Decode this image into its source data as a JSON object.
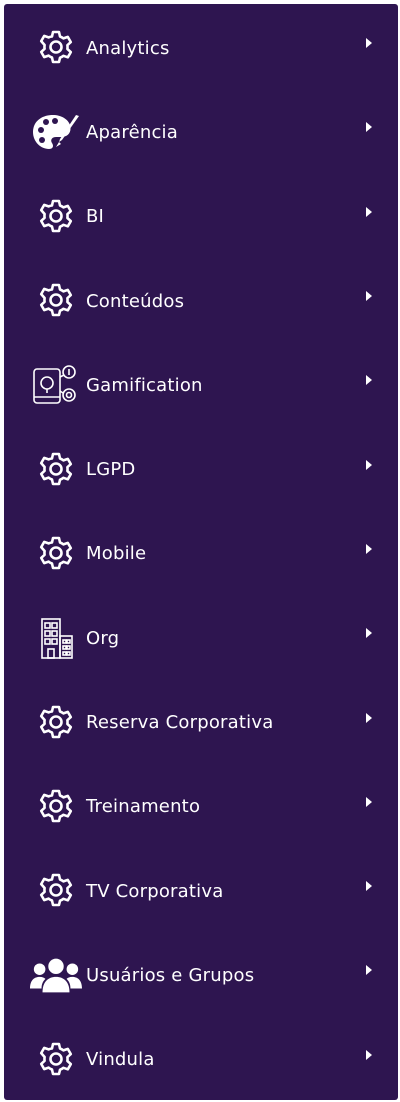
{
  "colors": {
    "menu_background": "#2e1550",
    "text": "#ffffff"
  },
  "menu": {
    "items": [
      {
        "label": "Analytics",
        "icon": "gear-icon"
      },
      {
        "label": "Aparência",
        "icon": "palette-icon"
      },
      {
        "label": "BI",
        "icon": "gear-icon"
      },
      {
        "label": "Conteúdos",
        "icon": "gear-icon"
      },
      {
        "label": "Gamification",
        "icon": "gamification-icon"
      },
      {
        "label": "LGPD",
        "icon": "gear-icon"
      },
      {
        "label": "Mobile",
        "icon": "gear-icon"
      },
      {
        "label": "Org",
        "icon": "building-icon"
      },
      {
        "label": "Reserva Corporativa",
        "icon": "gear-icon"
      },
      {
        "label": "Treinamento",
        "icon": "gear-icon"
      },
      {
        "label": "TV Corporativa",
        "icon": "gear-icon"
      },
      {
        "label": "Usuários e Grupos",
        "icon": "users-icon"
      },
      {
        "label": "Vindula",
        "icon": "gear-icon"
      }
    ]
  }
}
